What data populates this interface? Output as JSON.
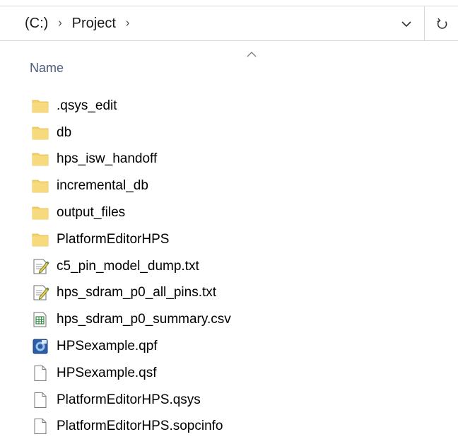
{
  "address": {
    "drive": "(C:)",
    "folder": "Project"
  },
  "columns": {
    "name": "Name"
  },
  "files": [
    {
      "name": ".qsys_edit",
      "icon": "folder-icon"
    },
    {
      "name": "db",
      "icon": "folder-icon"
    },
    {
      "name": "hps_isw_handoff",
      "icon": "folder-icon"
    },
    {
      "name": "incremental_db",
      "icon": "folder-icon"
    },
    {
      "name": "output_files",
      "icon": "folder-icon"
    },
    {
      "name": "PlatformEditorHPS",
      "icon": "folder-icon"
    },
    {
      "name": "c5_pin_model_dump.txt",
      "icon": "text-file-icon"
    },
    {
      "name": "hps_sdram_p0_all_pins.txt",
      "icon": "text-file-icon"
    },
    {
      "name": "hps_sdram_p0_summary.csv",
      "icon": "csv-file-icon"
    },
    {
      "name": "HPSexample.qpf",
      "icon": "quartus-project-icon"
    },
    {
      "name": "HPSexample.qsf",
      "icon": "blank-file-icon"
    },
    {
      "name": "PlatformEditorHPS.qsys",
      "icon": "blank-file-icon"
    },
    {
      "name": "PlatformEditorHPS.sopcinfo",
      "icon": "blank-file-icon"
    }
  ],
  "colors": {
    "folder": "#f5d06b",
    "header_text": "#4c607a",
    "border": "#d9d9d9"
  }
}
